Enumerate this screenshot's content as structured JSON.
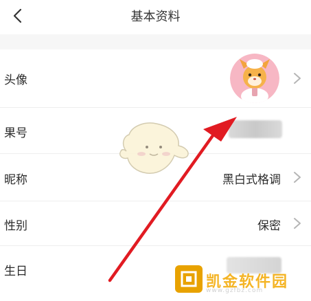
{
  "header": {
    "title": "基本资料"
  },
  "rows": [
    {
      "label": "头像",
      "value": ""
    },
    {
      "label": "果号",
      "value": ""
    },
    {
      "label": "昵称",
      "value": "黑白式格调"
    },
    {
      "label": "性别",
      "value": "保密"
    },
    {
      "label": "生日",
      "value": ""
    }
  ],
  "watermark": {
    "text": "凯金软件园",
    "sub": "www.gzfbz.com"
  },
  "colors": {
    "arrow": "#e11b22",
    "watermark": "#f3a700",
    "avatar_bg": "#f7b7c4"
  },
  "icons": [
    "back-chevron-icon",
    "chevron-right-icon",
    "avatar-character-image",
    "mascot-image"
  ]
}
